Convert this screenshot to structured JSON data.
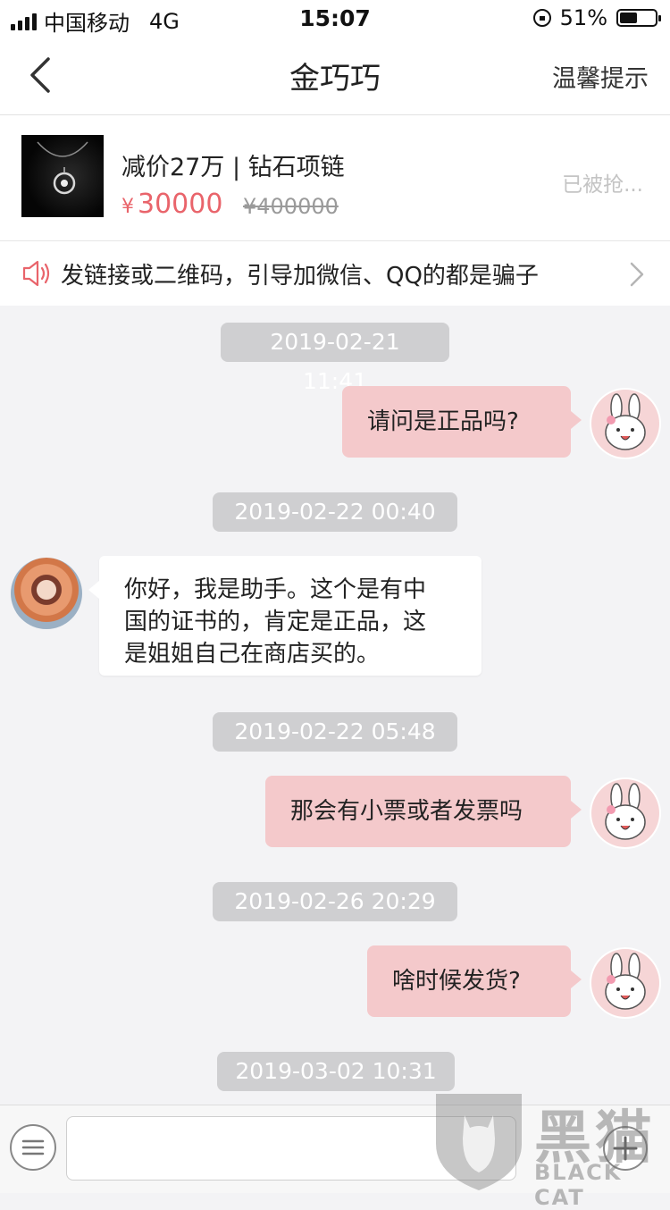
{
  "status_bar": {
    "carrier": "中国移动",
    "network": "4G",
    "time": "15:07",
    "battery_text": "51%",
    "battery_level": 0.51,
    "icons": [
      "signal-icon",
      "orientation-lock-icon",
      "battery-icon"
    ]
  },
  "nav": {
    "back_icon": "chevron-left-icon",
    "title": "金巧巧",
    "right_label": "温馨提示"
  },
  "product": {
    "name": "减价27万 | 钻石项链",
    "currency": "¥",
    "price": "30000",
    "original_price": "¥400000",
    "status": "已被抢..."
  },
  "warning": {
    "icon": "speaker-icon",
    "text": "发链接或二维码，引导加微信、QQ的都是骗子"
  },
  "messages": [
    {
      "type": "time",
      "text": "2019-02-21 11:41"
    },
    {
      "type": "sent",
      "text": "请问是正品吗?"
    },
    {
      "type": "time",
      "text": "2019-02-22 00:40"
    },
    {
      "type": "received",
      "lines": [
        "你好，我是助手。这个是有中",
        "国的证书的，肯定是正品，这",
        "是姐姐自己在商店买的。"
      ]
    },
    {
      "type": "time",
      "text": "2019-02-22 05:48"
    },
    {
      "type": "sent",
      "text": "那会有小票或者发票吗"
    },
    {
      "type": "time",
      "text": "2019-02-26 20:29"
    },
    {
      "type": "sent",
      "text": "啥时候发货?"
    },
    {
      "type": "time",
      "text": "2019-03-02 10:31"
    }
  ],
  "input_bar": {
    "menu_icon": "menu-icon",
    "placeholder": "",
    "plus_icon": "plus-icon"
  },
  "watermark": {
    "text_cn": "黑猫",
    "text_en": "BLACK CAT"
  },
  "colors": {
    "accent_pink": "#e9646b",
    "sent_bubble": "#f4c9cb",
    "timestamp_bg": "#cfcfd1",
    "chat_bg": "#f3f3f5"
  }
}
